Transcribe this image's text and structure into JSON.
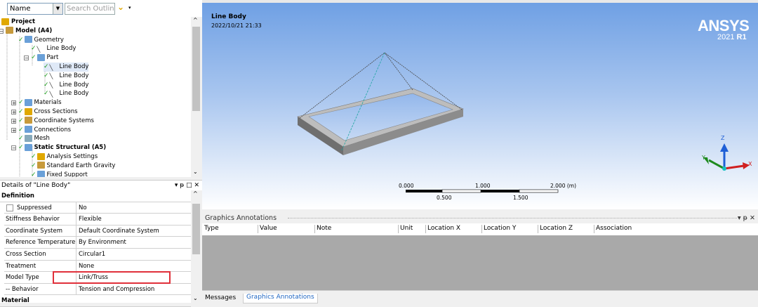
{
  "outline": {
    "name_select": "Name",
    "search_placeholder": "Search Outline",
    "tree": [
      {
        "label": "Project",
        "bold": true
      },
      {
        "label": "Model (A4)",
        "bold": true
      },
      {
        "label": "Geometry"
      },
      {
        "label": "Line Body"
      },
      {
        "label": "Part"
      },
      {
        "label": "Line Body",
        "selected": true
      },
      {
        "label": "Line Body"
      },
      {
        "label": "Line Body"
      },
      {
        "label": "Line Body"
      },
      {
        "label": "Materials"
      },
      {
        "label": "Cross Sections"
      },
      {
        "label": "Coordinate Systems"
      },
      {
        "label": "Connections"
      },
      {
        "label": "Mesh"
      },
      {
        "label": "Static Structural (A5)",
        "bold": true
      },
      {
        "label": "Analysis Settings"
      },
      {
        "label": "Standard Earth Gravity"
      },
      {
        "label": "Fixed Support"
      }
    ]
  },
  "details": {
    "title": "Details of \"Line Body\"",
    "controls": "▾ ᵽ □ ✕",
    "section_definition": "Definition",
    "rows": [
      {
        "key": "Suppressed",
        "value": "No"
      },
      {
        "key": "Stiffness Behavior",
        "value": "Flexible"
      },
      {
        "key": "Coordinate System",
        "value": "Default Coordinate System"
      },
      {
        "key": "Reference Temperature",
        "value": "By Environment"
      },
      {
        "key": "Cross Section",
        "value": "Circular1"
      },
      {
        "key": "Treatment",
        "value": "None"
      },
      {
        "key": "Model Type",
        "value": "Link/Truss"
      },
      {
        "key": "-- Behavior",
        "value": "Tension and Compression"
      }
    ],
    "section_material": "Material"
  },
  "viewport": {
    "title": "Line Body",
    "date": "2022/10/21 21:33",
    "logo": "ANSYS",
    "version_year": "2021",
    "version_release": "R1",
    "scale": {
      "t0": "0.000",
      "t1": "1.000",
      "t2": "2.000 (m)",
      "b1": "0.500",
      "b2": "1.500"
    },
    "axes": {
      "x": "X",
      "y": "Y",
      "z": "Z"
    },
    "colors": {
      "beam": "#9a9a9a",
      "truss": "#4a4a4a",
      "selected_truss": "#1fa6a0",
      "x_axis": "#d02020",
      "y_axis": "#1e8a1e",
      "z_axis": "#1f5fd6"
    }
  },
  "annotations": {
    "title": "Graphics Annotations",
    "controls": "▾ ᵽ ✕",
    "columns": [
      "Type",
      "Value",
      "Note",
      "Unit",
      "Location X",
      "Location Y",
      "Location Z",
      "Association"
    ]
  },
  "bottom_tabs": {
    "messages": "Messages",
    "graphics_annotations": "Graphics Annotations"
  }
}
